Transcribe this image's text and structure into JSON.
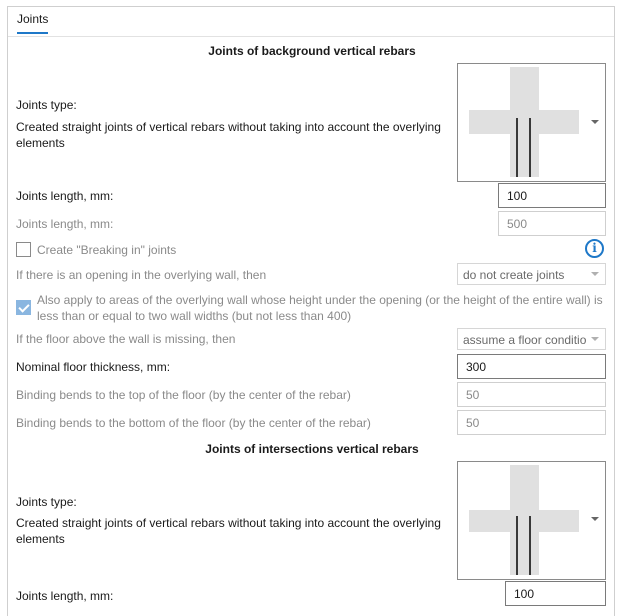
{
  "tab": {
    "label": "Joints"
  },
  "background": {
    "title": "Joints of background vertical rebars",
    "joints_type_label": "Joints type:",
    "joints_type_value": "Created straight joints of vertical rebars without taking into account the overlying elements",
    "joints_length_label": "Joints length, mm:",
    "joints_length_value": "100",
    "joints_length2_label": "Joints length, mm:",
    "joints_length2_value": "500",
    "breaking_in_label": "Create \"Breaking in\" joints",
    "opening_label": "If there is an opening in the overlying wall, then",
    "opening_value": "do not create joints",
    "also_apply_label": "Also apply to areas of the overlying wall whose height under the opening (or the height of the entire wall) is less than or equal to two wall widths (but not less than 400)",
    "floor_missing_label": "If the floor above the wall is missing, then",
    "floor_missing_value": "assume a floor condition",
    "nominal_thickness_label": "Nominal floor thickness, mm:",
    "nominal_thickness_value": "300",
    "bend_top_label": "Binding bends to the top of the floor (by the center of the rebar)",
    "bend_top_value": "50",
    "bend_bottom_label": "Binding bends to the bottom of the floor (by the center of the rebar)",
    "bend_bottom_value": "50"
  },
  "intersections": {
    "title": "Joints of intersections vertical rebars",
    "joints_type_label": "Joints type:",
    "joints_type_value": "Created straight joints of vertical rebars without taking into account the overlying elements",
    "joints_length_label": "Joints length, mm:",
    "joints_length_value": "100"
  },
  "icons": {
    "info": "info-icon",
    "dropdown": "chevron-down-icon"
  },
  "colors": {
    "accent": "#1e78c8",
    "disabled_text": "#8a8a8a"
  }
}
